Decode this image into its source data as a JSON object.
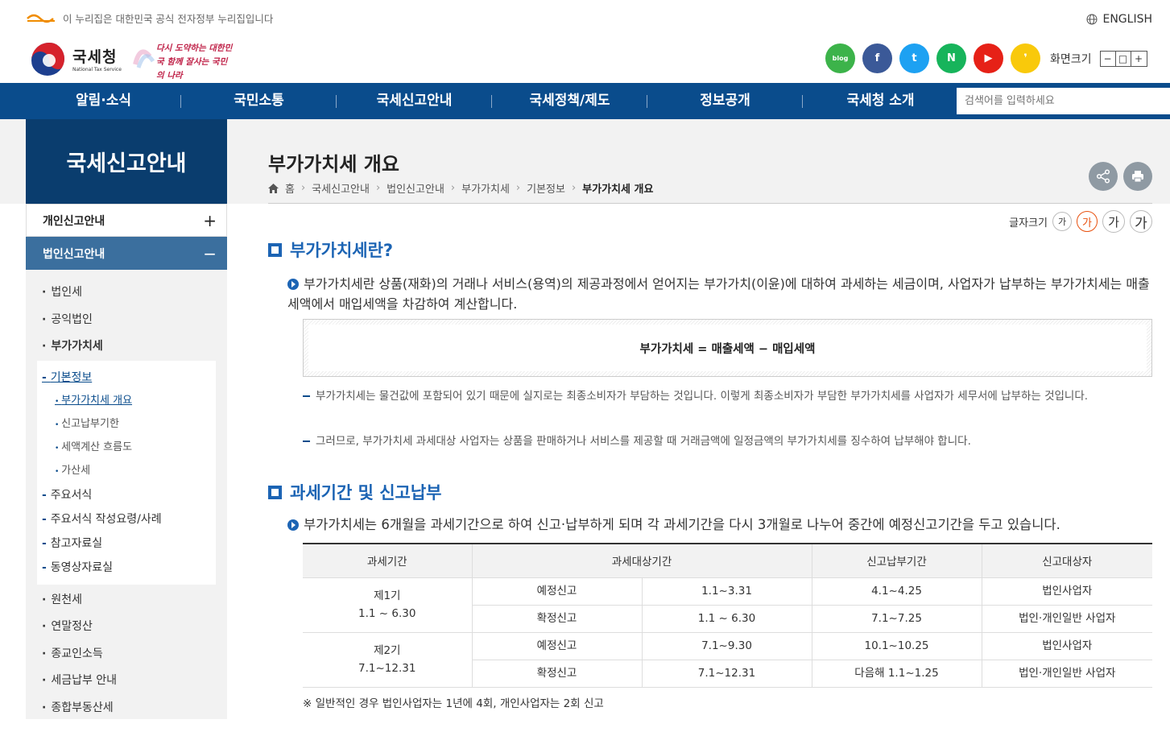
{
  "gov_banner": {
    "text": "이 누리집은 대한민국 공식 전자정부 누리집입니다"
  },
  "lang": {
    "english": "ENGLISH"
  },
  "logo": {
    "ko": "국세청",
    "en": "National Tax Service"
  },
  "slogan": {
    "text": "다시 도약하는 대한민국 함께 잘사는 국민의 나라"
  },
  "sns": [
    {
      "name": "blog",
      "label": "blog",
      "color": "#3cb34a"
    },
    {
      "name": "facebook",
      "label": "f",
      "color": "#3b5998"
    },
    {
      "name": "twitter",
      "label": "t",
      "color": "#1da1f2"
    },
    {
      "name": "naver-post",
      "label": "N",
      "color": "#17b45b"
    },
    {
      "name": "youtube",
      "label": "▶",
      "color": "#e62117"
    },
    {
      "name": "kakao",
      "label": "❜",
      "color": "#f9c90b"
    }
  ],
  "screen_size": {
    "label": "화면크기",
    "minus": "−",
    "reset": "□",
    "plus": "+"
  },
  "gnb": [
    "알림·소식",
    "국민소통",
    "국세신고안내",
    "국세정책/제도",
    "정보공개",
    "국세청 소개"
  ],
  "search": {
    "placeholder": "검색어를 입력하세요"
  },
  "lnb": {
    "title": "국세신고안내",
    "group1": {
      "label": "개인신고안내",
      "toggle": "+"
    },
    "group2": {
      "label": "법인신고안내",
      "toggle": "−"
    },
    "items_top": [
      "법인세",
      "공익법인",
      "부가가치세"
    ],
    "sub": [
      {
        "label": "기본정보",
        "level": 3,
        "active": true
      },
      {
        "label": "부가가치세 개요",
        "level": 4,
        "active": true
      },
      {
        "label": "신고납부기한",
        "level": 4,
        "active": false
      },
      {
        "label": "세액계산 흐름도",
        "level": 4,
        "active": false
      },
      {
        "label": "가산세",
        "level": 4,
        "active": false
      },
      {
        "label": "주요서식",
        "level": 3,
        "active": false
      },
      {
        "label": "주요서식 작성요령/사례",
        "level": 3,
        "active": false
      },
      {
        "label": "참고자료실",
        "level": 3,
        "active": false
      },
      {
        "label": "동영상자료실",
        "level": 3,
        "active": false
      }
    ],
    "items_bottom": [
      "원천세",
      "연말정산",
      "종교인소득",
      "세금납부 안내",
      "종합부동산세"
    ]
  },
  "page": {
    "title": "부가가치세 개요",
    "breadcrumb": [
      "홈",
      "국세신고안내",
      "법인신고안내",
      "부가가치세",
      "기본정보",
      "부가가치세 개요"
    ],
    "text_size_label": "글자크기",
    "text_size_options": [
      "가",
      "가",
      "가",
      "가"
    ]
  },
  "section1": {
    "title": "부가가치세란?",
    "para": "부가가치세란 상품(재화)의 거래나 서비스(용역)의 제공과정에서 얻어지는 부가가치(이윤)에 대하여 과세하는 세금이며, 사업자가 납부하는 부가가치세는 매출세액에서 매입세액을 차감하여 계산합니다.",
    "formula": "부가가치세 = 매출세액 − 매입세액",
    "dash1": "부가가치세는 물건값에 포함되어 있기 때문에 실지로는 최종소비자가 부담하는 것입니다. 이렇게 최종소비자가 부담한 부가가치세를 사업자가 세무서에 납부하는 것입니다.",
    "dash2": "그러므로, 부가가치세 과세대상 사업자는 상품을 판매하거나 서비스를 제공할 때 거래금액에 일정금액의 부가가치세를 징수하여 납부해야 합니다."
  },
  "section2": {
    "title": "과세기간 및 신고납부",
    "para": "부가가치세는 6개월을 과세기간으로 하여 신고·납부하게 되며 각 과세기간을 다시 3개월로 나누어 중간에 예정신고기간을 두고 있습니다.",
    "table": {
      "headers": [
        "과세기간",
        "과세대상기간",
        "신고납부기간",
        "신고대상자"
      ],
      "period1": {
        "name": "제1기",
        "range": "1.1 ~ 6.30"
      },
      "period2": {
        "name": "제2기",
        "range": "7.1~12.31"
      },
      "rows": [
        [
          "예정신고",
          "1.1~3.31",
          "4.1~4.25",
          "법인사업자"
        ],
        [
          "확정신고",
          "1.1 ~ 6.30",
          "7.1~7.25",
          "법인·개인일반 사업자"
        ],
        [
          "예정신고",
          "7.1~9.30",
          "10.1~10.25",
          "법인사업자"
        ],
        [
          "확정신고",
          "7.1~12.31",
          "다음해 1.1~1.25",
          "법인·개인일반 사업자"
        ]
      ]
    },
    "note": "※ 일반적인 경우 법인사업자는 1년에 4회, 개인사업자는 2회 신고"
  },
  "colors": {
    "primary": "#0a4c8c",
    "lnb_title": "#0a3d6e",
    "lnb_active": "#3b6f9e",
    "heading": "#1c64b4"
  }
}
